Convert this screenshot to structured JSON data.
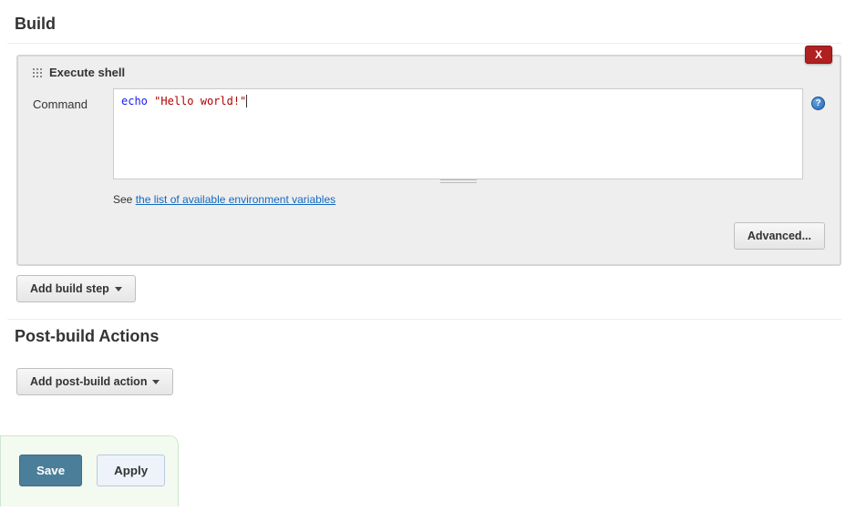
{
  "build": {
    "title": "Build",
    "step": {
      "title": "Execute shell",
      "delete_label": "X",
      "command_label": "Command",
      "command_tokens": {
        "cmd": "echo",
        "space": " ",
        "str": "\"Hello world!\""
      },
      "hint_prefix": "See ",
      "hint_link": "the list of available environment variables",
      "advanced_label": "Advanced..."
    },
    "add_step_label": "Add build step"
  },
  "postbuild": {
    "title": "Post-build Actions",
    "add_action_label": "Add post-build action"
  },
  "footer": {
    "save": "Save",
    "apply": "Apply"
  }
}
